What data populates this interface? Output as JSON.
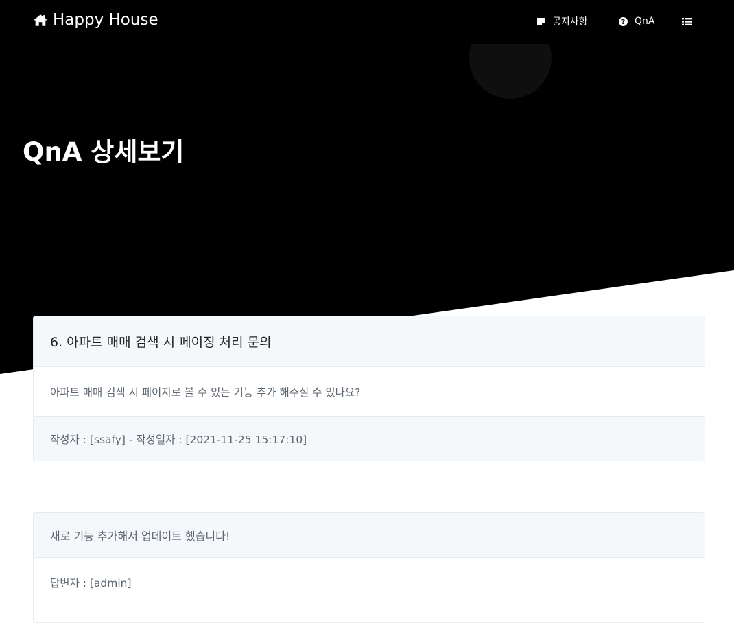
{
  "colors": {
    "hero_background": "#000000",
    "card_header": "#f5f8fb",
    "muted_text": "#5c6670",
    "border": "#e6ebf0"
  },
  "navbar": {
    "brand": "Happy House",
    "brand_icon": "home-icon",
    "items": [
      {
        "label": "공지사항",
        "icon": "note-icon"
      },
      {
        "label": "QnA",
        "icon": "question-circle-icon"
      },
      {
        "label": "",
        "icon": "list-icon"
      }
    ]
  },
  "page": {
    "title": "QnA 상세보기"
  },
  "question": {
    "title": "6. 아파트 매매 검색 시 페이징 처리 문의",
    "content": "아파트 매매 검색 시 페이지로 볼 수 있는 기능 추가 해주실 수 있나요?",
    "meta": "작성자 : [ssafy] - 작성일자 : [2021-11-25 15:17:10]"
  },
  "answer": {
    "content": "새로 기능 추가해서 업데이트 했습니다!",
    "author": "답변자 : [admin]"
  }
}
